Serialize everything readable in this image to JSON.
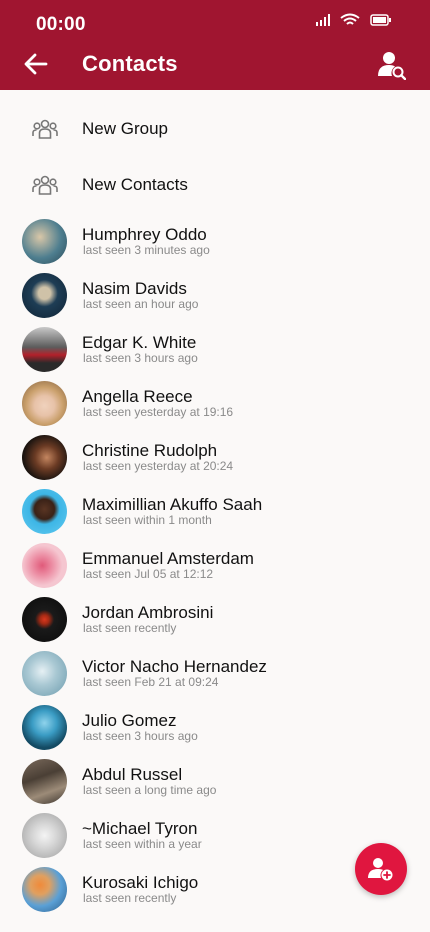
{
  "status_bar": {
    "time": "00:00"
  },
  "header": {
    "title": "Contacts"
  },
  "actions": [
    {
      "label": "New Group",
      "icon": "group-icon"
    },
    {
      "label": "New Contacts",
      "icon": "group-icon"
    }
  ],
  "contacts": [
    {
      "name": "Humphrey Oddo",
      "last_seen": "last seen 3 minutes ago"
    },
    {
      "name": "Nasim Davids",
      "last_seen": "last seen an hour ago"
    },
    {
      "name": "Edgar K. White",
      "last_seen": "last seen 3 hours ago"
    },
    {
      "name": "Angella Reece",
      "last_seen": "last seen yesterday at 19:16"
    },
    {
      "name": "Christine Rudolph",
      "last_seen": "last seen yesterday at 20:24"
    },
    {
      "name": "Maximillian Akuffo Saah",
      "last_seen": "last seen within 1 month"
    },
    {
      "name": "Emmanuel Amsterdam",
      "last_seen": "last seen Jul 05 at 12:12"
    },
    {
      "name": "Jordan Ambrosini",
      "last_seen": "last seen recently"
    },
    {
      "name": "Victor Nacho Hernandez",
      "last_seen": "last seen Feb 21 at 09:24"
    },
    {
      "name": "Julio Gomez",
      "last_seen": "last seen 3 hours ago"
    },
    {
      "name": "Abdul Russel",
      "last_seen": "last seen a long time ago"
    },
    {
      "name": "~Michael Tyron",
      "last_seen": "last seen within a year"
    },
    {
      "name": "Kurosaki Ichigo",
      "last_seen": "last seen recently"
    }
  ],
  "colors": {
    "header": "#a01530",
    "fab": "#e0163f",
    "background": "#fbf9f8"
  }
}
